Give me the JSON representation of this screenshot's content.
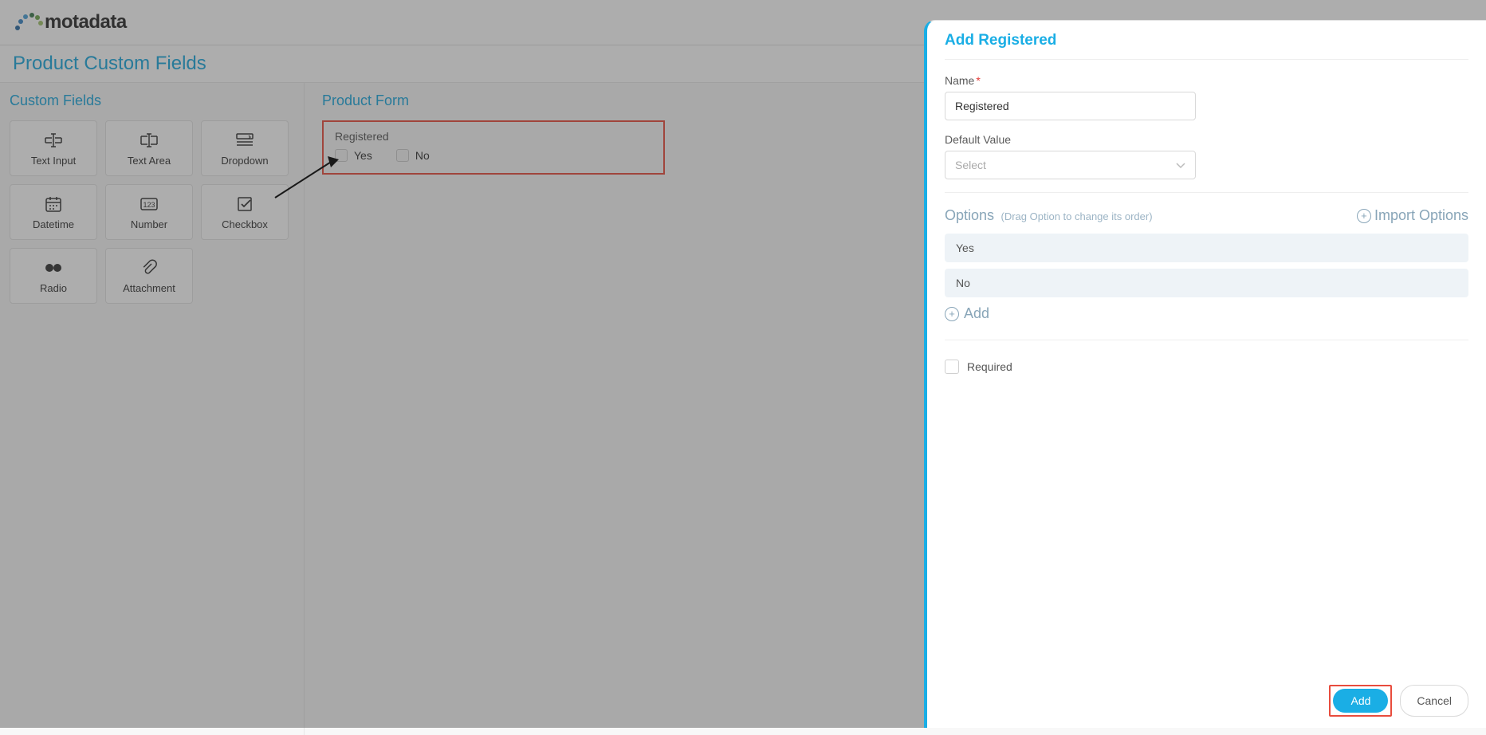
{
  "header": {
    "brand": "motadata"
  },
  "page": {
    "title": "Product Custom Fields"
  },
  "leftPanel": {
    "title": "Custom Fields",
    "fields": [
      "Text Input",
      "Text Area",
      "Dropdown",
      "Datetime",
      "Number",
      "Checkbox",
      "Radio",
      "Attachment"
    ]
  },
  "formPanel": {
    "title": "Product Form",
    "preview": {
      "label": "Registered",
      "options": [
        "Yes",
        "No"
      ]
    }
  },
  "sidePanel": {
    "title": "Add Registered",
    "nameLabel": "Name",
    "nameValue": "Registered",
    "defaultLabel": "Default Value",
    "defaultPlaceholder": "Select",
    "optionsTitle": "Options",
    "optionsHint": "(Drag Option to change its order)",
    "importLabel": "Import Options",
    "options": [
      "Yes",
      "No"
    ],
    "addOptionLabel": "Add",
    "requiredLabel": "Required",
    "addButton": "Add",
    "cancelButton": "Cancel"
  }
}
